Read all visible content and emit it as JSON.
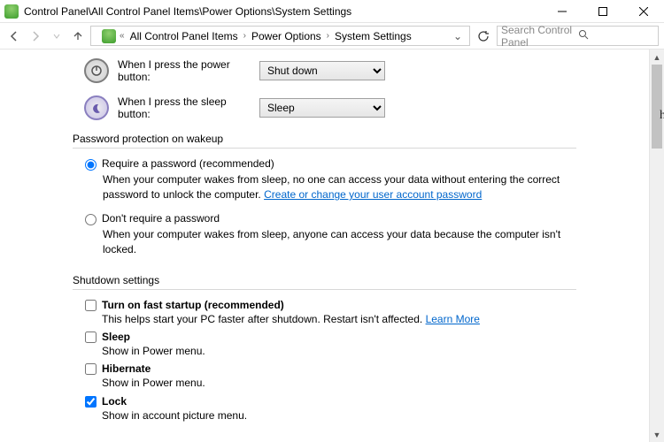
{
  "window": {
    "title": "Control Panel\\All Control Panel Items\\Power Options\\System Settings"
  },
  "breadcrumbs": {
    "prefix": "«",
    "items": [
      "All Control Panel Items",
      "Power Options",
      "System Settings"
    ]
  },
  "search": {
    "placeholder": "Search Control Panel"
  },
  "powerButton": {
    "label": "When I press the power button:",
    "value": "Shut down"
  },
  "sleepButton": {
    "label": "When I press the sleep button:",
    "value": "Sleep"
  },
  "passwordSection": {
    "heading": "Password protection on wakeup",
    "require": {
      "label": "Require a password (recommended)",
      "desc": "When your computer wakes from sleep, no one can access your data without entering the correct password to unlock the computer. ",
      "link": "Create or change your user account password"
    },
    "dont": {
      "label": "Don't require a password",
      "desc": "When your computer wakes from sleep, anyone can access your data because the computer isn't locked."
    }
  },
  "shutdownSection": {
    "heading": "Shutdown settings",
    "fastStartup": {
      "label": "Turn on fast startup (recommended)",
      "desc": "This helps start your PC faster after shutdown. Restart isn't affected. ",
      "link": "Learn More"
    },
    "sleep": {
      "label": "Sleep",
      "desc": "Show in Power menu."
    },
    "hibernate": {
      "label": "Hibernate",
      "desc": "Show in Power menu."
    },
    "lock": {
      "label": "Lock",
      "desc": "Show in account picture menu."
    }
  },
  "sideGlyph": "h"
}
